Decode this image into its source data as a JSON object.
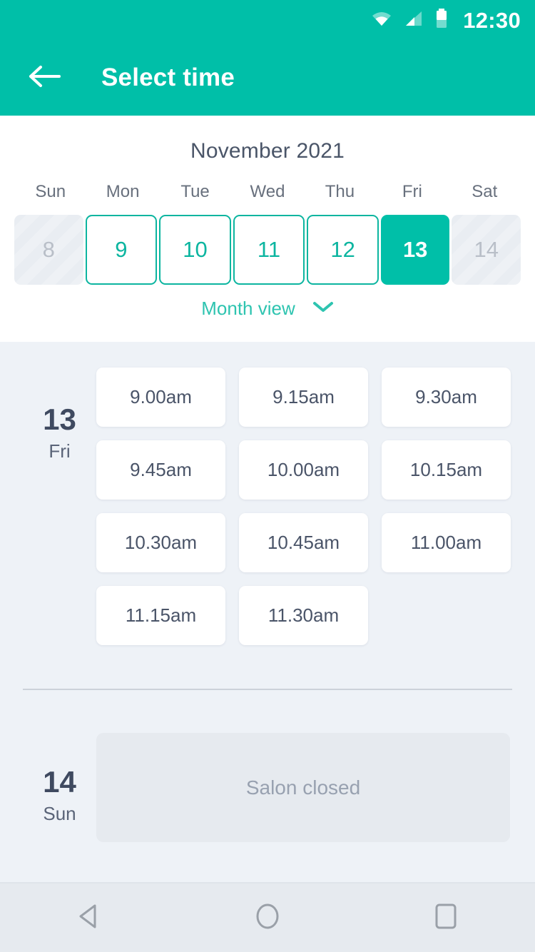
{
  "status_bar": {
    "time": "12:30",
    "icons": [
      "wifi-icon",
      "cellular-signal-icon",
      "battery-icon"
    ]
  },
  "app_bar": {
    "back_icon": "back-arrow-icon",
    "title": "Select time"
  },
  "calendar": {
    "month_title": "November 2021",
    "weekdays": [
      "Sun",
      "Mon",
      "Tue",
      "Wed",
      "Thu",
      "Fri",
      "Sat"
    ],
    "dates": [
      {
        "day": "8",
        "state": "disabled"
      },
      {
        "day": "9",
        "state": "available"
      },
      {
        "day": "10",
        "state": "available"
      },
      {
        "day": "11",
        "state": "available"
      },
      {
        "day": "12",
        "state": "available"
      },
      {
        "day": "13",
        "state": "selected"
      },
      {
        "day": "14",
        "state": "disabled"
      }
    ],
    "month_view_label": "Month view",
    "month_view_icon": "chevron-down-icon"
  },
  "slots_section": {
    "day": {
      "number": "13",
      "weekday": "Fri",
      "times": [
        "9.00am",
        "9.15am",
        "9.30am",
        "9.45am",
        "10.00am",
        "10.15am",
        "10.30am",
        "10.45am",
        "11.00am",
        "11.15am",
        "11.30am"
      ]
    },
    "closed_day": {
      "number": "14",
      "weekday": "Sun",
      "message": "Salon closed"
    }
  },
  "nav_bar": {
    "back_icon": "nav-back-triangle-icon",
    "home_icon": "nav-home-circle-icon",
    "recents_icon": "nav-recents-square-icon"
  },
  "colors": {
    "accent": "#00bfa8",
    "accent_border": "#0cb5a0",
    "page_background": "#eef2f7",
    "panel": "#ffffff",
    "text_dark": "#4a5468",
    "text_muted": "#98a1b0",
    "closed_panel": "#e6eaef"
  }
}
